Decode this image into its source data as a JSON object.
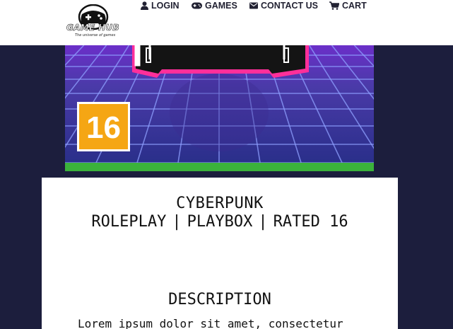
{
  "header": {
    "logo": {
      "name": "GAME HUB",
      "tagline": "The universe of games"
    },
    "nav": [
      {
        "label": "LOGIN",
        "icon": "user-icon"
      },
      {
        "label": "GAMES",
        "icon": "gamepad-icon"
      },
      {
        "label": "CONTACT US",
        "icon": "envelope-icon"
      },
      {
        "label": "CART",
        "icon": "cart-icon"
      }
    ]
  },
  "hero": {
    "age_rating": "16"
  },
  "game": {
    "title": "CYBERPUNK",
    "genre": "ROLEPLAY",
    "platform": "PLAYBOX",
    "rating_label": "RATED",
    "rating": "16",
    "separator": "|",
    "description_heading": "DESCRIPTION",
    "description": "Lorem ipsum dolor sit amet, consectetur"
  },
  "colors": {
    "page_background": "#1c1e3d",
    "header_background": "#ffffff",
    "accent_green": "#3bb23b",
    "rating_badge": "#f5a614",
    "neon_pink": "#ff2f9a",
    "grid_blue": "#7fa8ff"
  }
}
